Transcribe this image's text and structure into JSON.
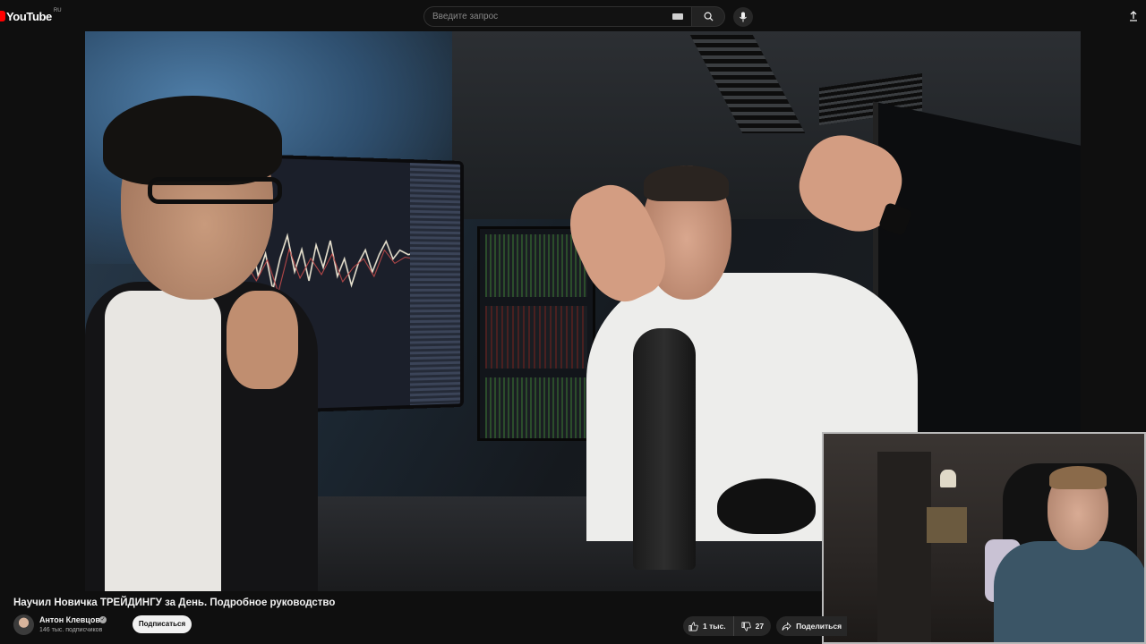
{
  "header": {
    "logo_text": "YouTube",
    "logo_region": "RU",
    "search_placeholder": "Введите запрос"
  },
  "video": {
    "title": "Научил Новичка ТРЕЙДИНГУ за День. Подробное руководство"
  },
  "channel": {
    "name": "Антон Клевцов",
    "subscribers": "146 тыс. подписчиков",
    "subscribe_label": "Подписаться"
  },
  "actions": {
    "likes": "1 тыс.",
    "dislikes": "27",
    "share_label": "Поделиться"
  },
  "colors": {
    "brand": "#ff0000",
    "background": "#0f0f0f",
    "button_bg": "#272727"
  }
}
